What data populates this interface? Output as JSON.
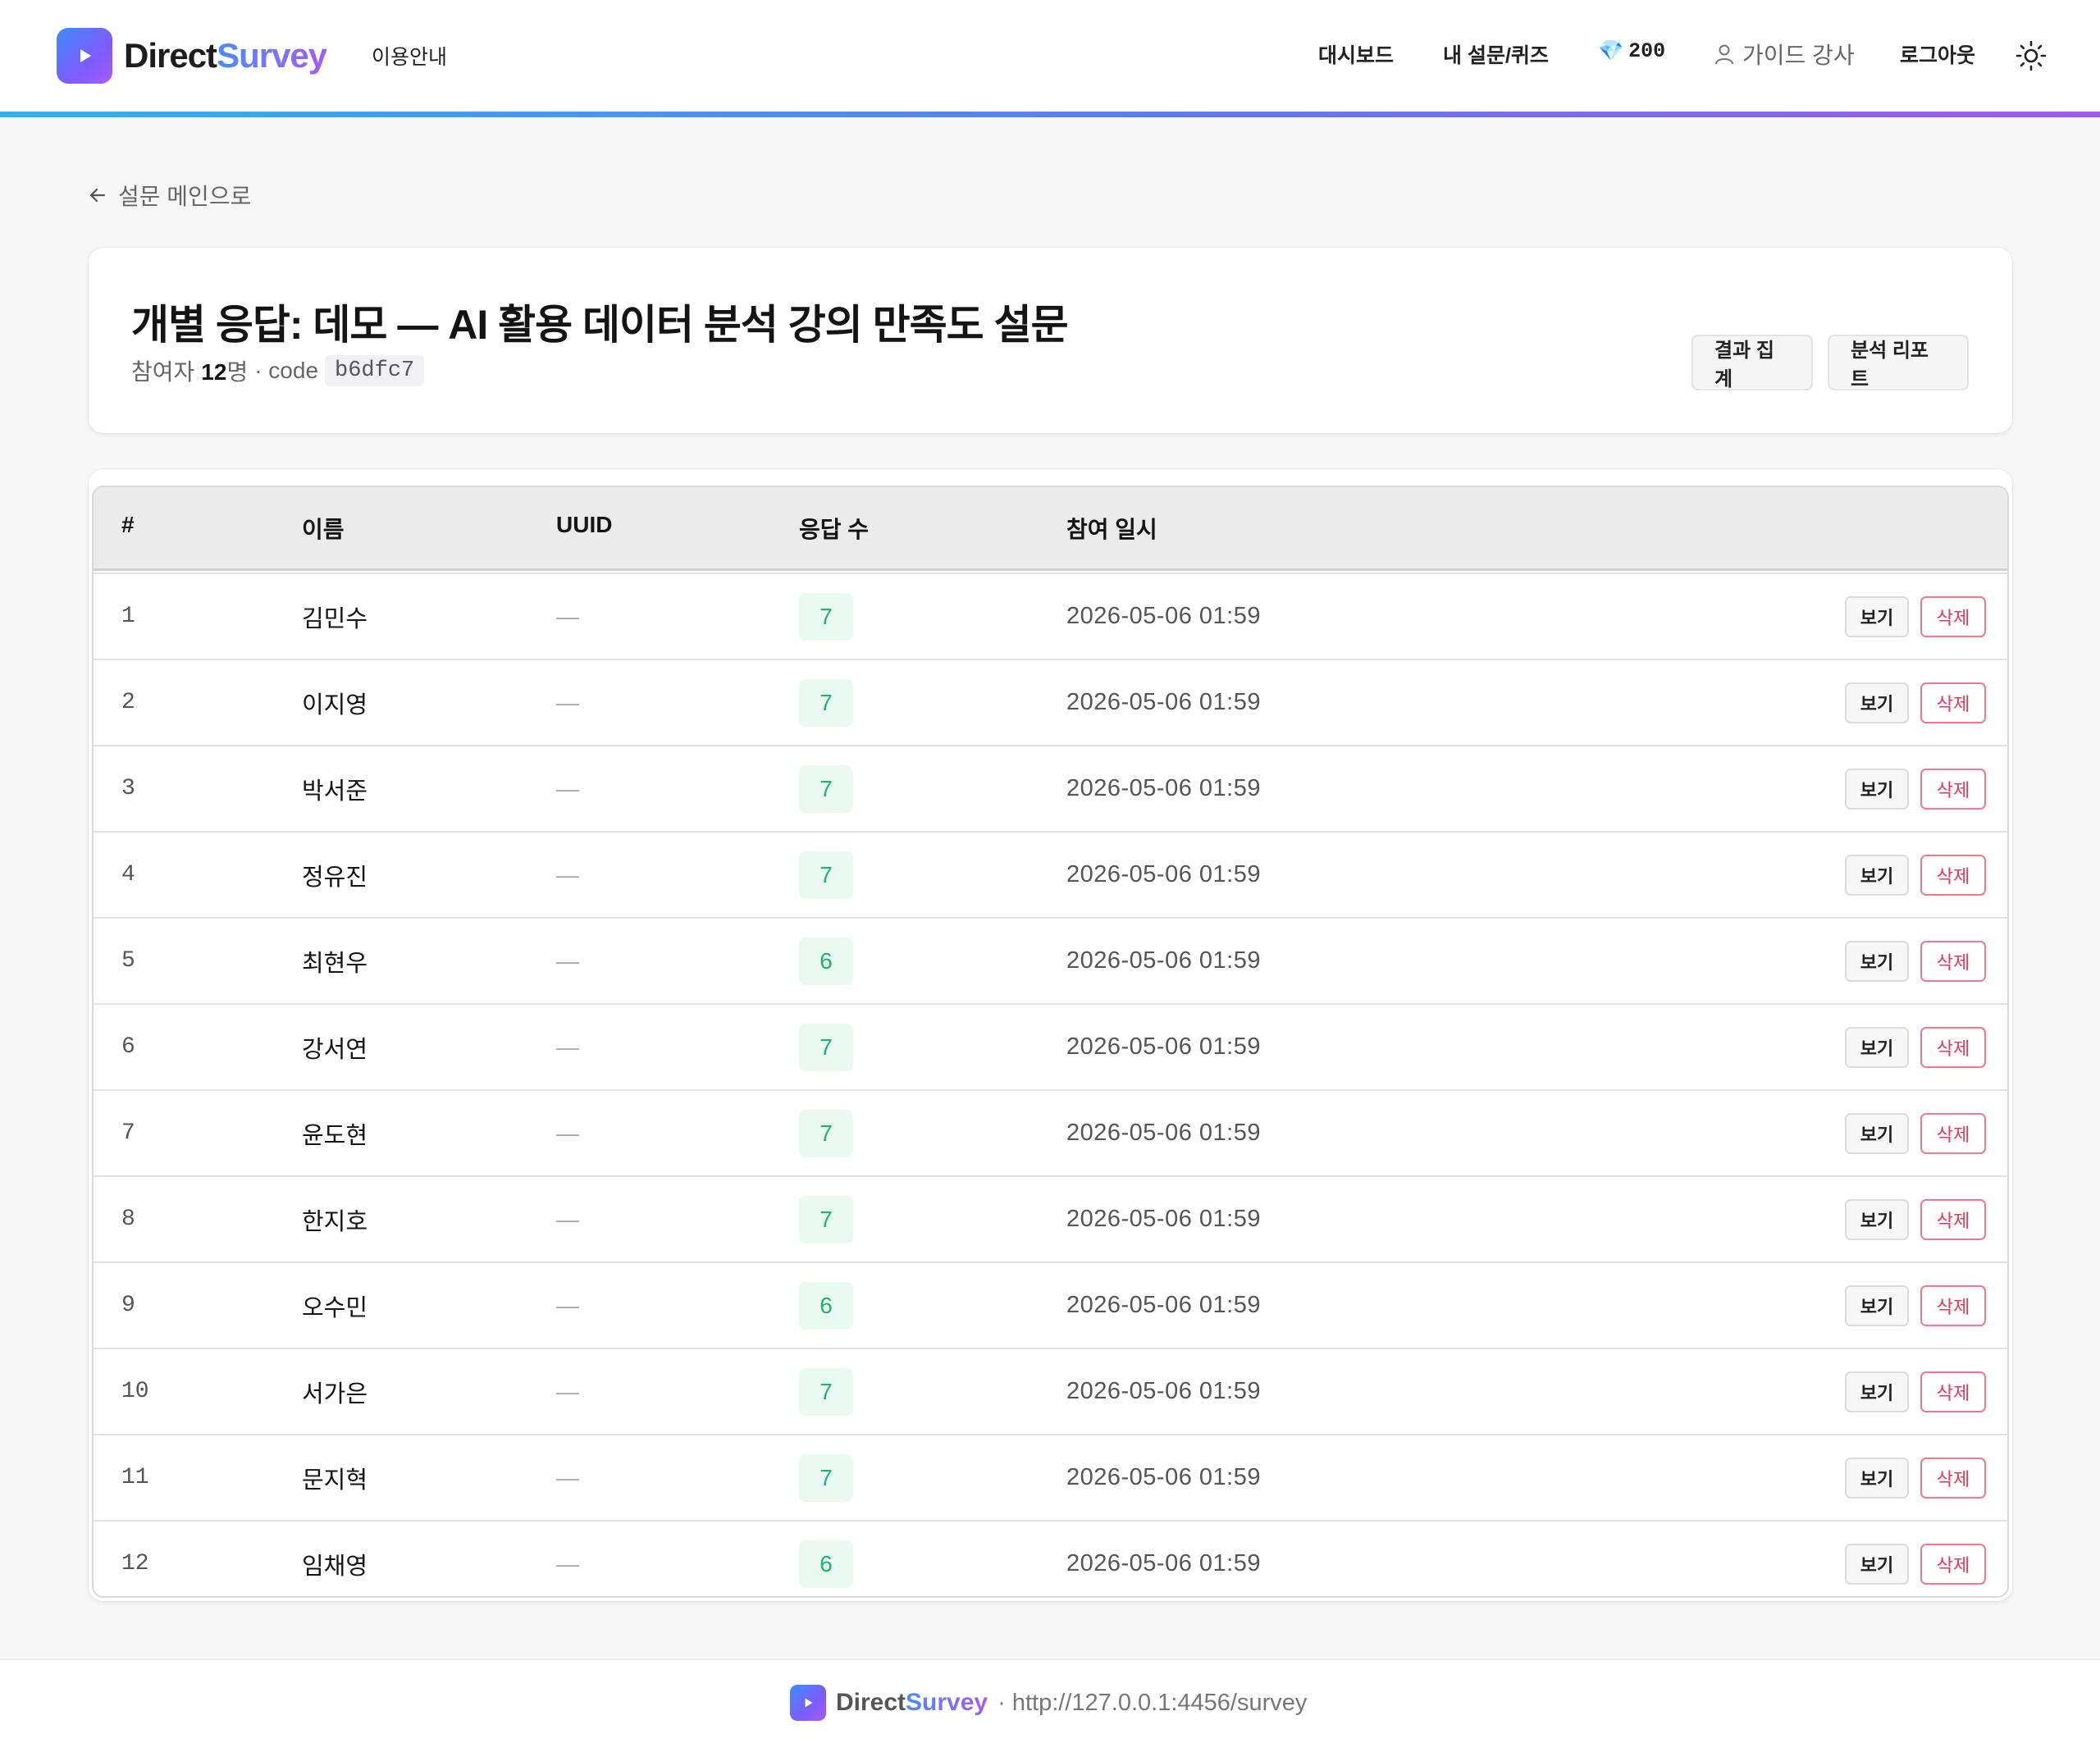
{
  "header": {
    "brand_part1": "Direct",
    "brand_part2": "Survey",
    "guide_link": "이용안내",
    "nav_dashboard": "대시보드",
    "nav_my_surveys": "내 설문/퀴즈",
    "credits_icon": "💎",
    "credits_value": "200",
    "user_name": "가이드 강사",
    "logout": "로그아웃",
    "theme_icon": "sun-icon"
  },
  "colors": {
    "accent_gradient_start": "#2bb3f0",
    "accent_gradient_end": "#a259f0",
    "badge_green": "#20b273",
    "delete_red": "#e23b58"
  },
  "back_link": "설문 메인으로",
  "survey": {
    "title": "개별 응답: 데모 — AI 활용 데이터 분석 강의 만족도 설문",
    "participants_label": "참여자",
    "participants_count": "12",
    "participants_unit": "명",
    "code_label": "· code",
    "code": "b6dfc7",
    "btn_aggregate": "결과 집계",
    "btn_report": "분석 리포트"
  },
  "table": {
    "columns": {
      "num": "#",
      "name": "이름",
      "uuid": "UUID",
      "count": "응답 수",
      "date": "참여 일시"
    },
    "view_label": "보기",
    "delete_label": "삭제",
    "rows": [
      {
        "num": "1",
        "name": "김민수",
        "uuid": "—",
        "count": "7",
        "date": "2026-05-06 01:59"
      },
      {
        "num": "2",
        "name": "이지영",
        "uuid": "—",
        "count": "7",
        "date": "2026-05-06 01:59"
      },
      {
        "num": "3",
        "name": "박서준",
        "uuid": "—",
        "count": "7",
        "date": "2026-05-06 01:59"
      },
      {
        "num": "4",
        "name": "정유진",
        "uuid": "—",
        "count": "7",
        "date": "2026-05-06 01:59"
      },
      {
        "num": "5",
        "name": "최현우",
        "uuid": "—",
        "count": "6",
        "date": "2026-05-06 01:59"
      },
      {
        "num": "6",
        "name": "강서연",
        "uuid": "—",
        "count": "7",
        "date": "2026-05-06 01:59"
      },
      {
        "num": "7",
        "name": "윤도현",
        "uuid": "—",
        "count": "7",
        "date": "2026-05-06 01:59"
      },
      {
        "num": "8",
        "name": "한지호",
        "uuid": "—",
        "count": "7",
        "date": "2026-05-06 01:59"
      },
      {
        "num": "9",
        "name": "오수민",
        "uuid": "—",
        "count": "6",
        "date": "2026-05-06 01:59"
      },
      {
        "num": "10",
        "name": "서가은",
        "uuid": "—",
        "count": "7",
        "date": "2026-05-06 01:59"
      },
      {
        "num": "11",
        "name": "문지혁",
        "uuid": "—",
        "count": "7",
        "date": "2026-05-06 01:59"
      },
      {
        "num": "12",
        "name": "임채영",
        "uuid": "—",
        "count": "6",
        "date": "2026-05-06 01:59"
      }
    ]
  },
  "footer": {
    "brand_part1": "Direct",
    "brand_part2": "Survey",
    "url_text": "· http://127.0.0.1:4456/survey"
  }
}
